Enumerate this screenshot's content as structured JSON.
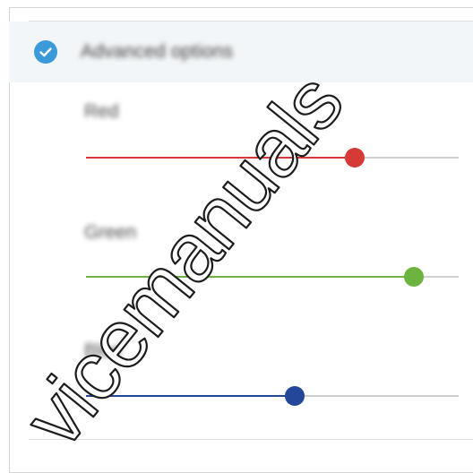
{
  "advanced": {
    "title": "Advanced options",
    "checked": true,
    "check_color": "#3b9ad9"
  },
  "sliders": [
    {
      "label": "Red",
      "value": 0.72,
      "color": "#d63a35"
    },
    {
      "label": "Green",
      "value": 0.88,
      "color": "#6cb33f"
    },
    {
      "label": "Blue",
      "value": 0.56,
      "color": "#25479a"
    }
  ],
  "watermark": {
    "text": "devicemanuals",
    "text_visible": "vicemanuals"
  }
}
